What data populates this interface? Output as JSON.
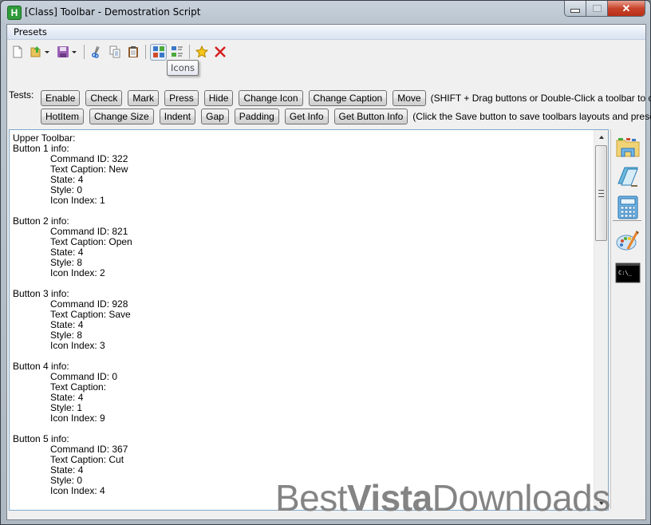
{
  "window": {
    "title": "[Class] Toolbar - Demostration Script",
    "app_icon_letter": "H",
    "controls": {
      "minimize": "minimize",
      "maximize": "maximize",
      "close": "✕"
    }
  },
  "menu": {
    "items": [
      {
        "label": "Presets"
      }
    ]
  },
  "toolbar": {
    "buttons": [
      {
        "name": "new",
        "icon": "new-document-icon"
      },
      {
        "name": "open",
        "icon": "open-folder-icon",
        "has_dropdown": true
      },
      {
        "name": "save",
        "icon": "floppy-save-icon",
        "has_dropdown": true
      },
      {
        "name": "cut",
        "icon": "scissors-icon"
      },
      {
        "name": "copy",
        "icon": "copy-icon"
      },
      {
        "name": "paste",
        "icon": "clipboard-icon"
      },
      {
        "name": "icons",
        "icon": "icons-view-icon",
        "pressed": true
      },
      {
        "name": "list",
        "icon": "list-view-icon"
      },
      {
        "name": "favorite",
        "icon": "star-icon"
      },
      {
        "name": "delete",
        "icon": "red-x-icon"
      }
    ],
    "tooltip": "Icons"
  },
  "tests": {
    "label": "Tests:",
    "row1": [
      "Enable",
      "Check",
      "Mark",
      "Press",
      "Hide",
      "Change Icon",
      "Change Caption",
      "Move"
    ],
    "row1_hint": "(SHIFT + Drag buttons or Double-Click a toolbar to customize it)",
    "row2": [
      "HotItem",
      "Change Size",
      "Indent",
      "Gap",
      "Padding",
      "Get Info",
      "Get Button Info"
    ],
    "row2_hint": "(Click the Save button to save toolbars layouts and presets)"
  },
  "output": {
    "header": "Upper Toolbar:",
    "buttons": [
      {
        "title": "Button 1 info:",
        "command_id": "Command ID: 322",
        "caption": "Text Caption: New",
        "state": "State: 4",
        "style": "Style: 0",
        "icon_index": "Icon Index: 1"
      },
      {
        "title": "Button 2 info:",
        "command_id": "Command ID: 821",
        "caption": "Text Caption: Open",
        "state": "State: 4",
        "style": "Style: 8",
        "icon_index": "Icon Index: 2"
      },
      {
        "title": "Button 3 info:",
        "command_id": "Command ID: 928",
        "caption": "Text Caption: Save",
        "state": "State: 4",
        "style": "Style: 8",
        "icon_index": "Icon Index: 3"
      },
      {
        "title": "Button 4 info:",
        "command_id": "Command ID: 0",
        "caption": "Text Caption:",
        "state": "State: 4",
        "style": "Style: 1",
        "icon_index": "Icon Index: 9"
      },
      {
        "title": "Button 5 info:",
        "command_id": "Command ID: 367",
        "caption": "Text Caption: Cut",
        "state": "State: 4",
        "style": "Style: 0",
        "icon_index": "Icon Index: 4"
      }
    ]
  },
  "side_toolbar": {
    "buttons": [
      {
        "name": "explorer",
        "icon": "explorer-folder-icon"
      },
      {
        "name": "notepad",
        "icon": "notepad-icon"
      },
      {
        "name": "calculator",
        "icon": "calculator-icon"
      },
      {
        "name": "paint",
        "icon": "paint-palette-icon"
      },
      {
        "name": "command-prompt",
        "icon": "command-prompt-icon",
        "text": "C:\\_"
      }
    ]
  },
  "watermark": {
    "part1": "Best",
    "part2": "Vista",
    "part3": "Downloads"
  }
}
